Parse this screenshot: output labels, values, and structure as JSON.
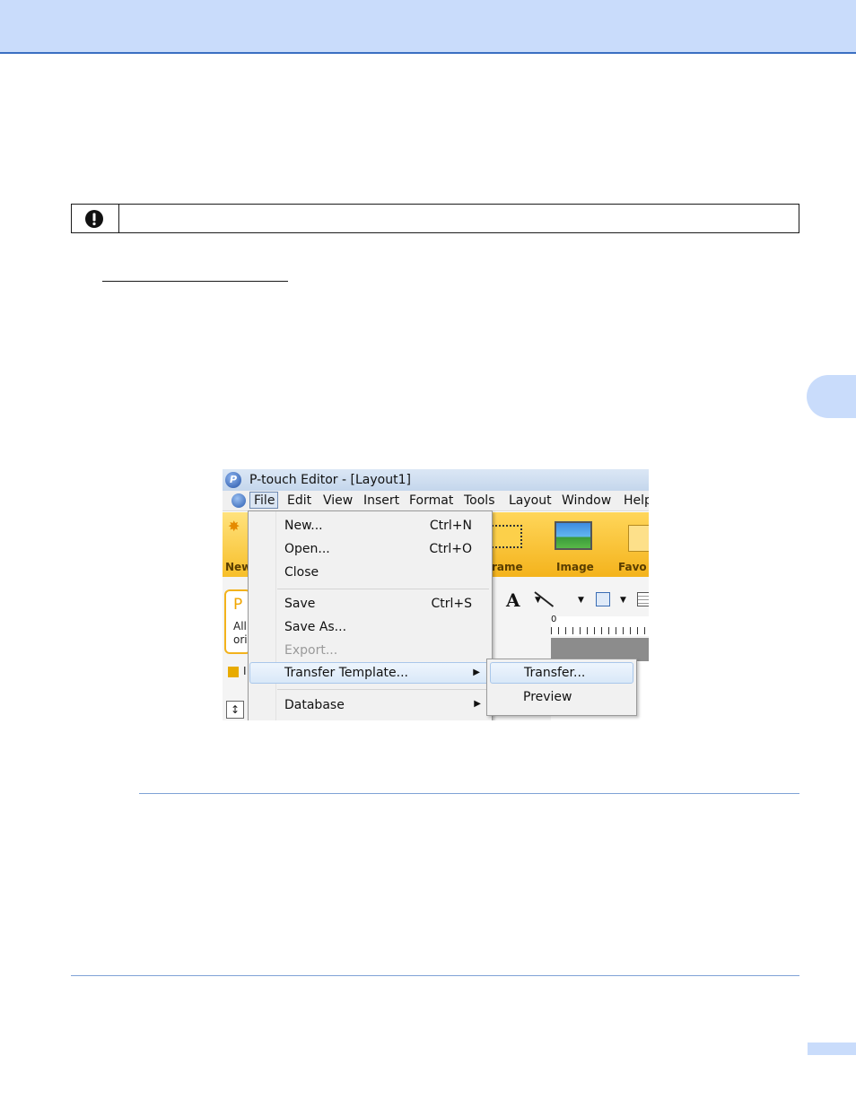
{
  "screenshot": {
    "title": "P-touch Editor - [Layout1]",
    "menubar": [
      "File",
      "Edit",
      "View",
      "Insert",
      "Format",
      "Tools",
      "Layout",
      "Window",
      "Help"
    ],
    "ribbon": {
      "new_label": "New",
      "frame_label": "rame",
      "image_label": "Image",
      "favorites_label": "Favo"
    },
    "side_panel": {
      "letter": "P",
      "line1": "All",
      "line2": "ori",
      "item": "I"
    },
    "ruler_zero": "0",
    "file_menu": [
      {
        "label": "New...",
        "shortcut": "Ctrl+N"
      },
      {
        "label": "Open...",
        "shortcut": "Ctrl+O"
      },
      {
        "label": "Close",
        "shortcut": ""
      },
      {
        "label": "Save",
        "shortcut": "Ctrl+S"
      },
      {
        "label": "Save As...",
        "shortcut": ""
      },
      {
        "label": "Export...",
        "shortcut": ""
      },
      {
        "label": "Transfer Template...",
        "shortcut": ""
      },
      {
        "label": "Database",
        "shortcut": ""
      }
    ],
    "submenu": [
      "Transfer...",
      "Preview"
    ]
  }
}
